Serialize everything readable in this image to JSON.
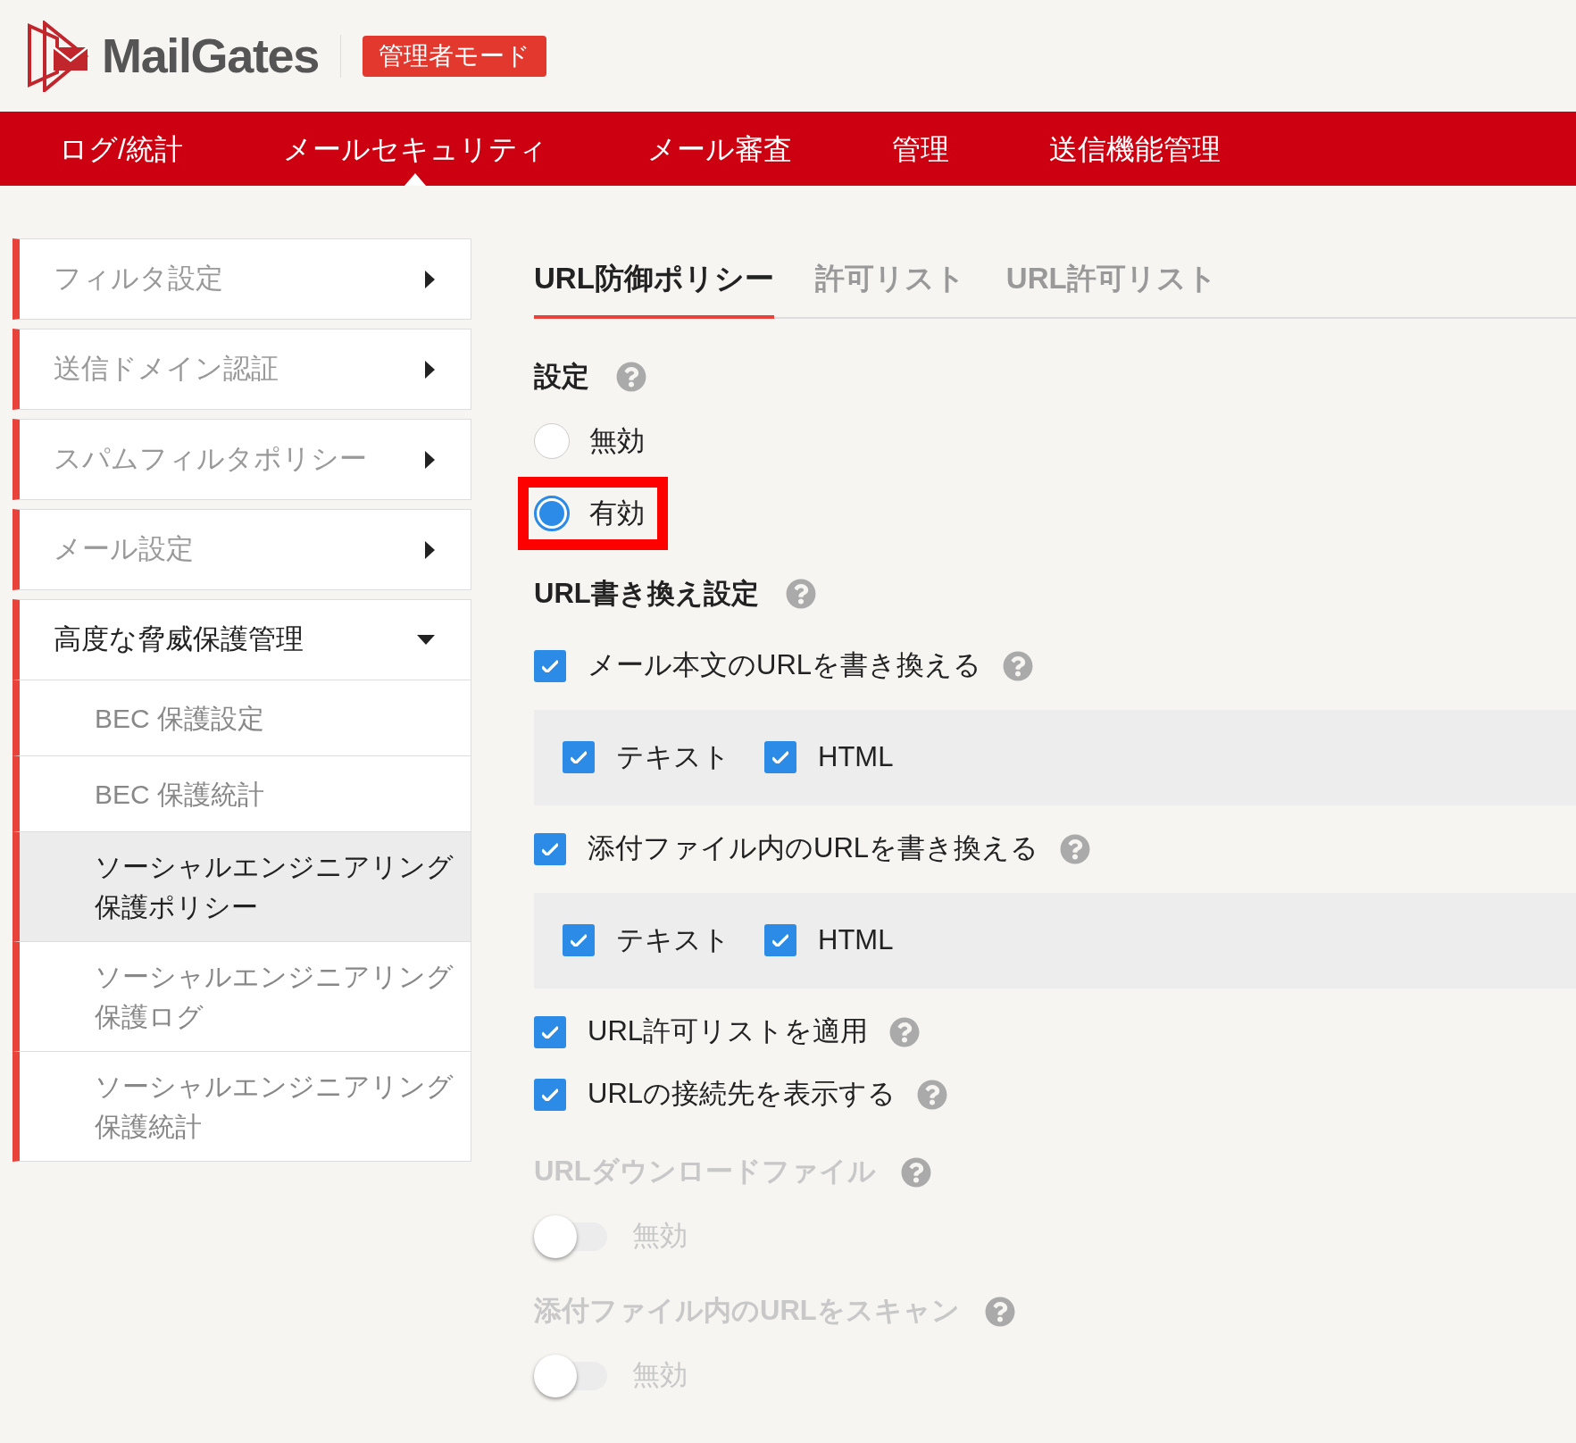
{
  "header": {
    "logo_text": "MailGates",
    "mode_badge": "管理者モード"
  },
  "nav": [
    {
      "label": "ログ/統計",
      "selected": false
    },
    {
      "label": "メールセキュリティ",
      "selected": true
    },
    {
      "label": "メール審査",
      "selected": false
    },
    {
      "label": "管理",
      "selected": false
    },
    {
      "label": "送信機能管理",
      "selected": false
    }
  ],
  "sidebar": {
    "items": [
      {
        "label": "フィルタ設定",
        "expanded": false
      },
      {
        "label": "送信ドメイン認証",
        "expanded": false
      },
      {
        "label": "スパムフィルタポリシー",
        "expanded": false
      },
      {
        "label": "メール設定",
        "expanded": false
      },
      {
        "label": "高度な脅威保護管理",
        "expanded": true,
        "children": [
          {
            "label": "BEC 保護設定",
            "selected": false
          },
          {
            "label": "BEC 保護統計",
            "selected": false
          },
          {
            "label": "ソーシャルエンジニアリング保護ポリシー",
            "selected": true
          },
          {
            "label": "ソーシャルエンジニアリング保護ログ",
            "selected": false
          },
          {
            "label": "ソーシャルエンジニアリング保護統計",
            "selected": false
          }
        ]
      }
    ]
  },
  "tabs": [
    {
      "label": "URL防御ポリシー",
      "selected": true
    },
    {
      "label": "許可リスト",
      "selected": false
    },
    {
      "label": "URL許可リスト",
      "selected": false
    }
  ],
  "setting": {
    "title": "設定",
    "options": [
      {
        "label": "無効",
        "selected": false,
        "highlighted": false
      },
      {
        "label": "有効",
        "selected": true,
        "highlighted": true
      }
    ]
  },
  "rewrite": {
    "title": "URL書き換え設定",
    "items": [
      {
        "kind": "group",
        "label": "メール本文のURLを書き換える",
        "checked": true,
        "sub": [
          {
            "label": "テキスト",
            "checked": true
          },
          {
            "label": "HTML",
            "checked": true
          }
        ]
      },
      {
        "kind": "group",
        "label": "添付ファイル内のURLを書き換える",
        "checked": true,
        "sub": [
          {
            "label": "テキスト",
            "checked": true
          },
          {
            "label": "HTML",
            "checked": true
          }
        ]
      },
      {
        "kind": "check",
        "label": "URL許可リストを適用",
        "checked": true
      },
      {
        "kind": "check",
        "label": "URLの接続先を表示する",
        "checked": true
      }
    ]
  },
  "toggles": [
    {
      "title": "URLダウンロードファイル",
      "disabled": true,
      "on": false,
      "state_label": "無効"
    },
    {
      "title": "添付ファイル内のURLをスキャン",
      "disabled": true,
      "on": false,
      "state_label": "無効"
    }
  ]
}
